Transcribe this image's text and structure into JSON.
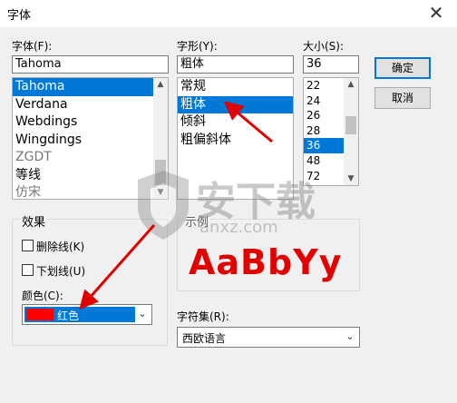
{
  "window": {
    "title": "字体",
    "close_glyph": "✕"
  },
  "font": {
    "label": "字体(F):",
    "value": "Tahoma",
    "items": [
      {
        "text": "Tahoma",
        "selected": true
      },
      {
        "text": "Verdana",
        "selected": false
      },
      {
        "text": "Webdings",
        "selected": false
      },
      {
        "text": "Wingdings",
        "selected": false
      },
      {
        "text": "ZGDT",
        "selected": false,
        "gray": true
      },
      {
        "text": "等线",
        "selected": false
      },
      {
        "text": "仿宋",
        "selected": false,
        "gray": true
      }
    ]
  },
  "style": {
    "label": "字形(Y):",
    "value": "粗体",
    "items": [
      {
        "text": "常规",
        "selected": false
      },
      {
        "text": "粗体",
        "selected": true
      },
      {
        "text": "倾斜",
        "selected": false
      },
      {
        "text": "粗偏斜体",
        "selected": false
      }
    ]
  },
  "size": {
    "label": "大小(S):",
    "value": "36",
    "items": [
      {
        "text": "22",
        "selected": false
      },
      {
        "text": "24",
        "selected": false
      },
      {
        "text": "26",
        "selected": false
      },
      {
        "text": "28",
        "selected": false
      },
      {
        "text": "36",
        "selected": true
      },
      {
        "text": "48",
        "selected": false
      },
      {
        "text": "72",
        "selected": false
      }
    ]
  },
  "buttons": {
    "ok": "确定",
    "cancel": "取消"
  },
  "effects": {
    "group_label": "效果",
    "strikeout": "删除线(K)",
    "underline": "下划线(U)",
    "color_label": "颜色(C):",
    "color_value": "红色",
    "color_hex": "#ff0000"
  },
  "sample": {
    "label": "示例",
    "text": "AaBbYy"
  },
  "charset": {
    "label": "字符集(R):",
    "value": "西欧语言"
  },
  "watermark": {
    "text": "安下载",
    "sub": "anxz.com"
  },
  "colors": {
    "accent": "#0078d7",
    "arrow": "#e00000",
    "sample": "#e30000"
  }
}
